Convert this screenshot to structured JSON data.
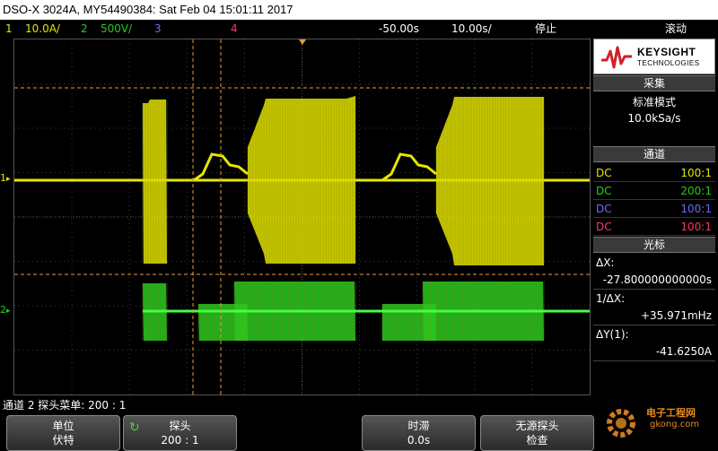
{
  "window": {
    "title": "DSO-X 3024A, MY54490384: Sat Feb 04 15:01:11 2017"
  },
  "status": {
    "ch1_num": "1",
    "ch1_scale": "10.0A/",
    "ch2_num": "2",
    "ch2_scale": "500V/",
    "ch3_num": "3",
    "ch4_num": "4",
    "delay": "-50.00s",
    "timebase": "10.00s/",
    "run_state": "停止",
    "mode": "滚动"
  },
  "panel": {
    "brand": "KEYSIGHT",
    "brand_sub": "TECHNOLOGIES",
    "acq_title": "采集",
    "acq_mode": "标准模式",
    "acq_rate": "10.0kSa/s",
    "channels_title": "通道",
    "channels": [
      {
        "coupling": "DC",
        "probe": "100:1"
      },
      {
        "coupling": "DC",
        "probe": "200:1"
      },
      {
        "coupling": "DC",
        "probe": "100:1"
      },
      {
        "coupling": "DC",
        "probe": "100:1"
      }
    ],
    "cursor_title": "光标",
    "dx_label": "ΔX:",
    "dx_value": "-27.800000000000s",
    "inv_dx_label": "1/ΔX:",
    "inv_dx_value": "+35.971mHz",
    "dy_label": "ΔY(1):",
    "dy_value": "-41.6250A"
  },
  "screen": {
    "ch1_marker": "1",
    "ch2_marker": "2"
  },
  "menu": {
    "title": "通道 2 探头菜单: 200 : 1"
  },
  "softkeys": [
    {
      "top": "单位",
      "bottom": "伏特"
    },
    {
      "top": "探头",
      "bottom": "200 : 1"
    },
    {
      "top": "时滞",
      "bottom": "0.0s"
    },
    {
      "top": "无源探头",
      "bottom": "检查"
    }
  ],
  "watermark": {
    "line1": "电子工程网",
    "line2": "gkong.com"
  },
  "colors": {
    "ch1": "#e6e600",
    "ch2": "#22cc22",
    "ch3": "#6a6aff",
    "ch4": "#ff3366",
    "cursor": "#e89a3c"
  }
}
